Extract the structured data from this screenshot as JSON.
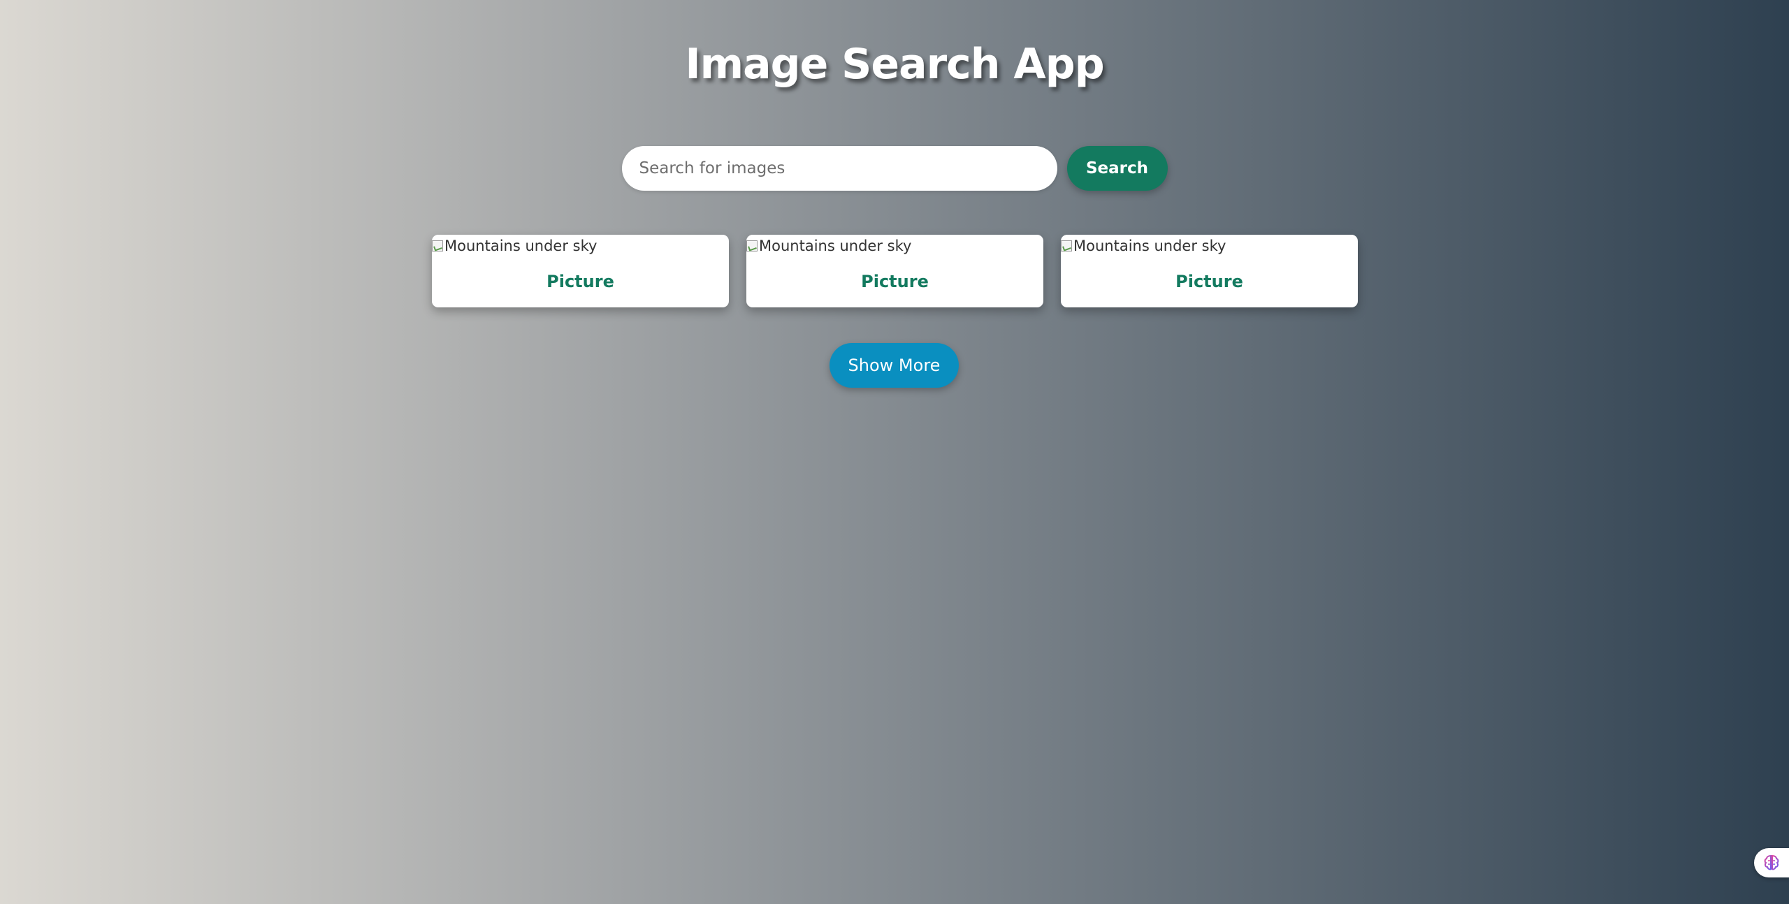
{
  "header": {
    "title": "Image Search App"
  },
  "search": {
    "placeholder": "Search for images",
    "value": "",
    "button_label": "Search"
  },
  "results": [
    {
      "image_alt": "Mountains under sky",
      "link_label": "Picture"
    },
    {
      "image_alt": "Mountains under sky",
      "link_label": "Picture"
    },
    {
      "image_alt": "Mountains under sky",
      "link_label": "Picture"
    }
  ],
  "show_more_label": "Show More",
  "widget": {
    "icon": "brain-icon"
  },
  "colors": {
    "accent_green": "#137a5f",
    "accent_blue": "#0a8fc0",
    "bg_gradient_start": "#dbd8d2",
    "bg_gradient_end": "#2e4050"
  }
}
